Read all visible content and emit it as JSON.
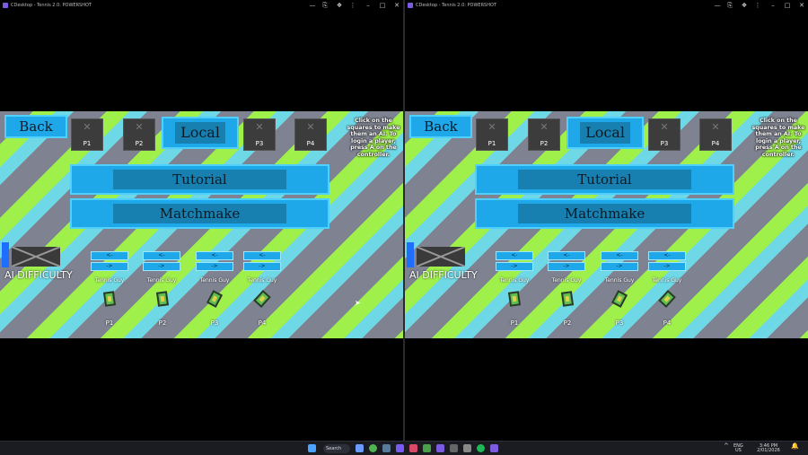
{
  "window": {
    "title": "CDesktop - Tennis 2.0: POWERSHOT",
    "controls": [
      "—",
      "⎘",
      "❖",
      "⋮",
      "–",
      "□",
      "✕"
    ]
  },
  "menu": {
    "back_label": "Back",
    "local_label": "Local",
    "tutorial_label": "Tutorial",
    "matchmake_label": "Matchmake",
    "slots": [
      "P1",
      "P2",
      "P3",
      "P4"
    ],
    "hint": "Click on the squares to make them an AI. To login a player, press A on the controller.",
    "ai_difficulty_label": "AI DIFFICULTY",
    "arrow_prev": "<-",
    "arrow_next": "->",
    "characters": [
      {
        "name": "Tennis Guy",
        "player": "P1"
      },
      {
        "name": "Tennis Guy",
        "player": "P2"
      },
      {
        "name": "Tennis Guy",
        "player": "P3"
      },
      {
        "name": "Tennis Guy",
        "player": "P4"
      }
    ]
  },
  "taskbar": {
    "search_label": "Search",
    "lang_top": "ENG",
    "lang_bottom": "US",
    "time": "3:46 PM",
    "date": "2/01/2026"
  },
  "colors": {
    "stripe_gray": "#7f8391",
    "stripe_green": "#9ff04a",
    "stripe_cyan": "#6fd8e6",
    "button_blue": "#1ea8ea"
  }
}
